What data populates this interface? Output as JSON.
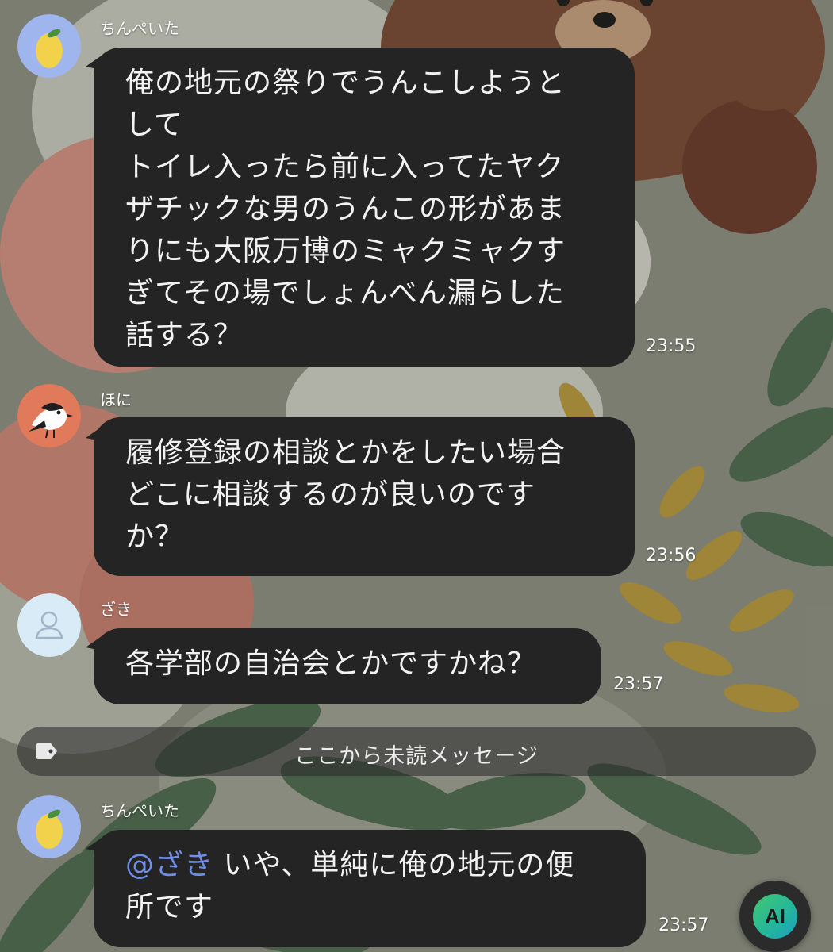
{
  "messages": [
    {
      "sender": "ちんぺいた",
      "avatar": "lemon-avatar-icon",
      "lines": [
        "俺の地元の祭りでうんこしようと",
        "して",
        "トイレ入ったら前に入ってたヤク",
        "ザチックな男のうんこの形があま",
        "りにも大阪万博のミャクミャクす",
        "ぎてその場でしょんべん漏らした",
        "話する？"
      ],
      "time": "23:55"
    },
    {
      "sender": "ほに",
      "avatar": "bird-avatar-icon",
      "lines": [
        "履修登録の相談とかをしたい場合",
        "どこに相談するのが良いのです",
        "か？"
      ],
      "time": "23:56"
    },
    {
      "sender": "ざき",
      "avatar": "default-user-avatar-icon",
      "lines": [
        "各学部の自治会とかですかね？"
      ],
      "time": "23:57"
    },
    {
      "sender": "ちんぺいた",
      "avatar": "lemon-avatar-icon",
      "mention": "@ざき",
      "lines": [
        "いや、単純に俺の地元の便",
        "所です"
      ],
      "time": "23:57"
    }
  ],
  "unread_divider": {
    "label": "ここから未読メッセージ",
    "icon": "tag-icon"
  },
  "ai_button": {
    "label": "AI"
  },
  "colors": {
    "bubble": "#242424",
    "bubble_text": "#f2f2f2",
    "mention": "#6f8ee8",
    "lemon_avatar_bg": "#9fb5ee",
    "bird_avatar_bg": "#e07a5b",
    "default_avatar_bg": "#d9ebf7"
  }
}
